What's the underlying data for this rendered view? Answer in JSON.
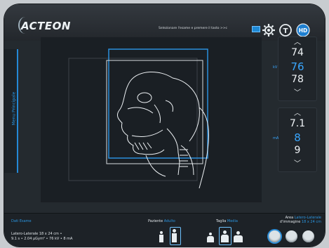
{
  "brand": {
    "logo_text": "ACTEON"
  },
  "header": {
    "hint": "Selezionare l'esame e premere il tasto >>c",
    "icons": [
      "settings-gear-icon",
      "t-mode-icon",
      "hd-icon"
    ]
  },
  "sidebar": {
    "tab_label": "Menu Principale"
  },
  "kv": {
    "unit": "kV",
    "values": [
      "74",
      "76",
      "78"
    ]
  },
  "ma": {
    "unit": "mA",
    "values": [
      "7.1",
      "8",
      "9"
    ]
  },
  "bottom": {
    "dati_title": "Dati Esame",
    "dati_line1": "Latero-Laterale 18 x 24 cm •",
    "dati_line2": "9.1 s • 2.04 µGym² • 76 kV • 8 mA",
    "paziente_label": "Paziente",
    "paziente_value": "Adulto",
    "taglia_label": "Taglia",
    "taglia_value": "Media",
    "area_label": "Area",
    "area_value": "Latero-Laterale",
    "immagine_label": "d'immagine",
    "immagine_value": "18 x 24 cm"
  },
  "colors": {
    "accent": "#2a95e0",
    "background": "#23282d"
  }
}
